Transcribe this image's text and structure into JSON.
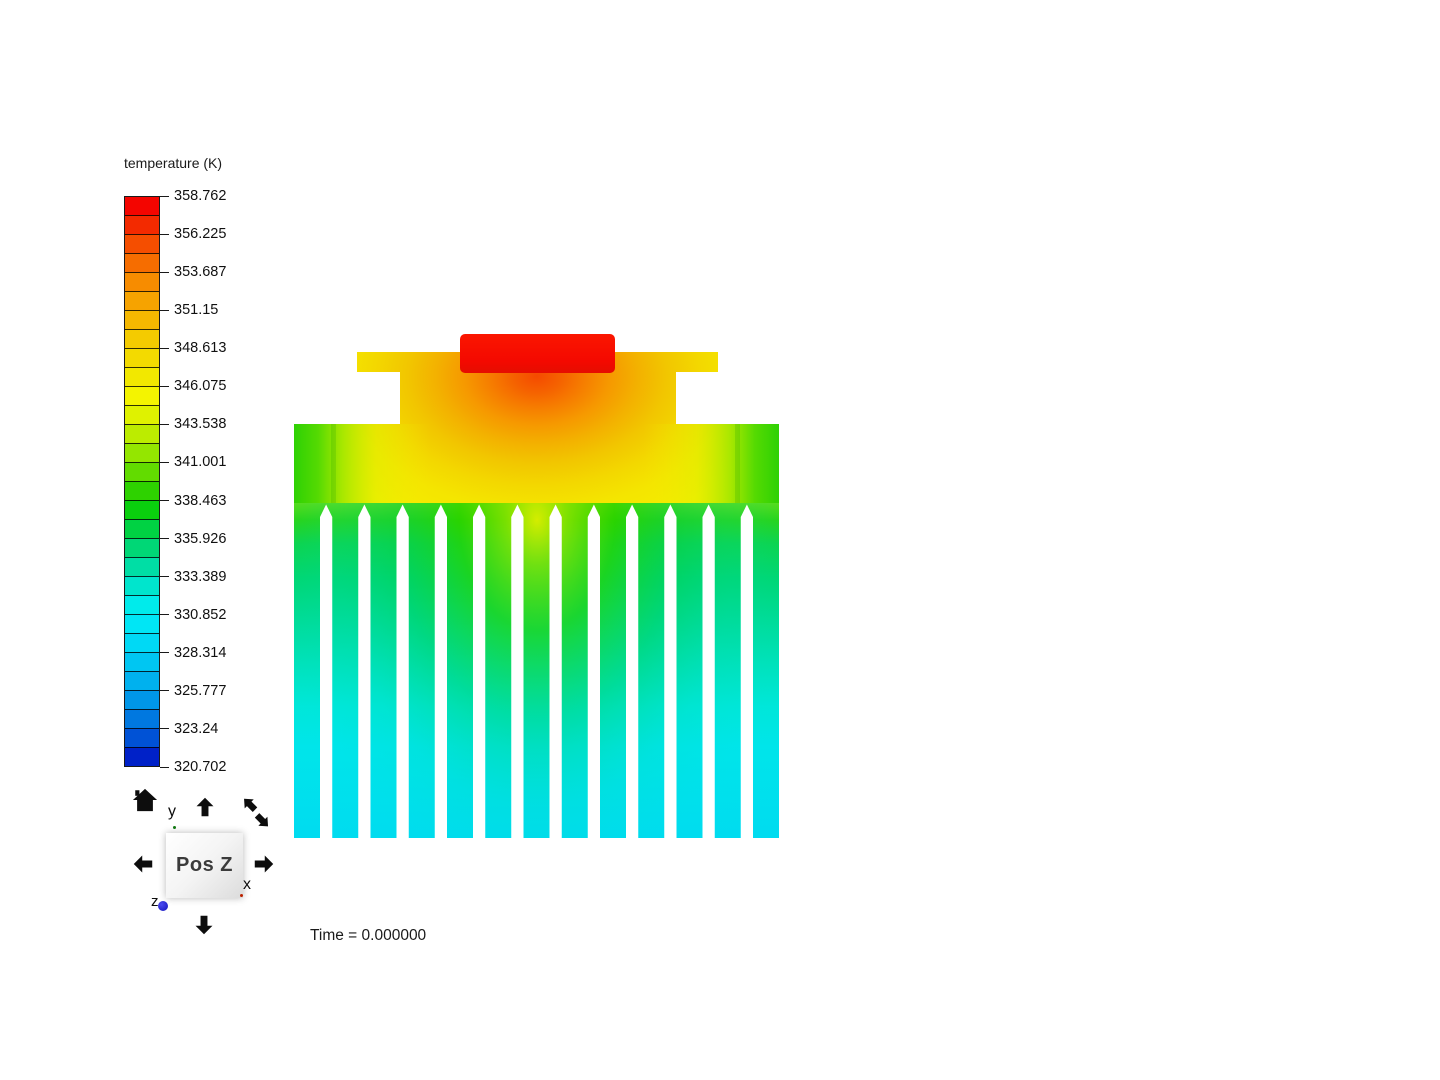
{
  "legend": {
    "title": "temperature (K)",
    "ticks": [
      "358.762",
      "356.225",
      "353.687",
      "351.15",
      "348.613",
      "346.075",
      "343.538",
      "341.001",
      "338.463",
      "335.926",
      "333.389",
      "330.852",
      "328.314",
      "325.777",
      "323.24",
      "320.702"
    ],
    "colors": [
      "#F40500",
      "#F32A00",
      "#F54E00",
      "#F66D00",
      "#F78C00",
      "#F6A300",
      "#F5B800",
      "#F4CB00",
      "#F3DA00",
      "#F2E800",
      "#F4F400",
      "#DFF200",
      "#BCEC00",
      "#94E600",
      "#62DC00",
      "#2ED200",
      "#0ACF0E",
      "#00D243",
      "#00D776",
      "#00DEA5",
      "#00E5CD",
      "#00EBEB",
      "#00E6F5",
      "#00D9F5",
      "#00C6F2",
      "#00B1EE",
      "#0096E8",
      "#0078E0",
      "#0052D6",
      "#0021C8"
    ]
  },
  "status": {
    "time_label": "Time = 0.000000"
  },
  "view_cube": {
    "face_label": "Pos Z",
    "axis_x": "x",
    "axis_y": "y",
    "axis_z": "z",
    "axis_colors": {
      "x": "#bb2200",
      "y": "#117711",
      "z": "#1f1fd4"
    }
  },
  "icons": {
    "home": "home-icon",
    "pan_up": "arrow-up-icon",
    "pan_down": "arrow-down-icon",
    "pan_left": "arrow-left-icon",
    "pan_right": "arrow-right-icon",
    "rotate": "rotate-diagonal-arrows-icon"
  },
  "visualization": {
    "type": "temperature-contour",
    "subject": "finned heatsink cross-section with heat-source chip on top",
    "fin_count": 13,
    "max_temperature_k": 358.762,
    "min_temperature_k": 320.702,
    "key_colors": {
      "chip_hot": "#F40900",
      "body_warm_yellow": "#F5EC00",
      "glow_orange": "#F66D00",
      "base_edge_green": "#2FD107",
      "fin_mid_green": "#00D776",
      "fin_cool_cyan": "#00DBF0"
    }
  }
}
